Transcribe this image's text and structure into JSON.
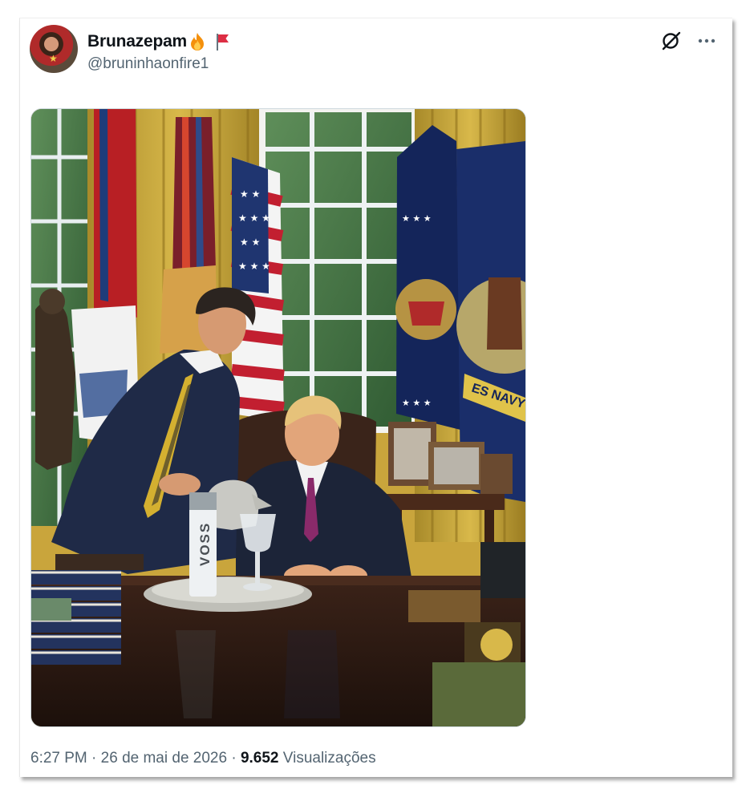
{
  "post": {
    "author": {
      "display_name": "Brunazepam",
      "handle": "@bruninhaonfire1",
      "name_emojis": [
        "fire-emoji",
        "red-flag-emoji"
      ]
    },
    "actions": {
      "grok_icon": "grok-icon",
      "more_icon": "more-icon"
    },
    "media": {
      "type": "photo",
      "bottle_text": "VOSS",
      "flag_text": "ES NAVY"
    },
    "meta": {
      "time": "6:27 PM",
      "separator": "·",
      "date": "26 de mai de 2026",
      "views_count": "9.652",
      "views_label": "Visualizações"
    }
  },
  "colors": {
    "text_primary": "#0f1419",
    "text_secondary": "#536471",
    "border": "#cfd9de"
  }
}
